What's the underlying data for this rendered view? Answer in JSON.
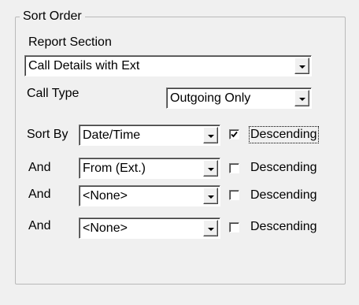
{
  "group_title": "Sort Order",
  "report_section": {
    "label": "Report Section",
    "value": "Call Details with Ext"
  },
  "call_type": {
    "label": "Call Type",
    "value": "Outgoing Only"
  },
  "sort_rows": [
    {
      "label": "Sort By",
      "field": "Date/Time",
      "checkbox_label": "Descending",
      "checked": true
    },
    {
      "label": "And",
      "field": "From (Ext.)",
      "checkbox_label": "Descending",
      "checked": false
    },
    {
      "label": "And",
      "field": "<None>",
      "checkbox_label": "Descending",
      "checked": false
    },
    {
      "label": "And",
      "field": "<None>",
      "checkbox_label": "Descending",
      "checked": false
    }
  ]
}
